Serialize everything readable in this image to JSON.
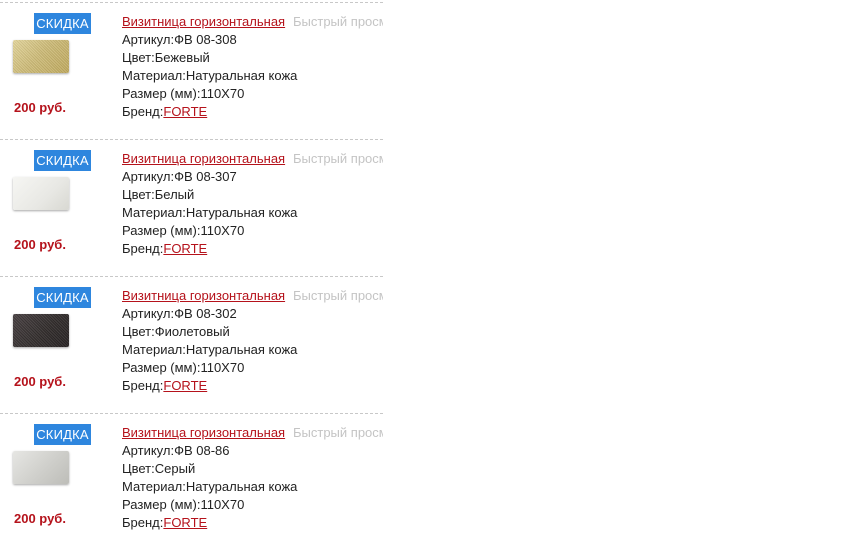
{
  "products": [
    {
      "badge": "СКИДКА",
      "title": "Визитница горизонтальная",
      "quick_view": "Быстрый просмотр",
      "article_label": "Артикул:",
      "article": "ФВ 08-308",
      "color_label": "Цвет:",
      "color": "Бежевый",
      "material_label": "Материал:",
      "material": "Натуральная кожа",
      "size_label": "Размер (мм):",
      "size": "110Х70",
      "brand_label": "Бренд:",
      "brand": "FORTE",
      "price": "200 руб."
    },
    {
      "badge": "СКИДКА",
      "title": "Визитница горизонтальная",
      "quick_view": "Быстрый просмотр",
      "article_label": "Артикул:",
      "article": "ФВ 08-307",
      "color_label": "Цвет:",
      "color": "Белый",
      "material_label": "Материал:",
      "material": "Натуральная кожа",
      "size_label": "Размер (мм):",
      "size": "110Х70",
      "brand_label": "Бренд:",
      "brand": "FORTE",
      "price": "200 руб."
    },
    {
      "badge": "СКИДКА",
      "title": "Визитница горизонтальная",
      "quick_view": "Быстрый просмотр",
      "article_label": "Артикул:",
      "article": "ФВ 08-302",
      "color_label": "Цвет:",
      "color": "Фиолетовый",
      "material_label": "Материал:",
      "material": "Натуральная кожа",
      "size_label": "Размер (мм):",
      "size": "110Х70",
      "brand_label": "Бренд:",
      "brand": "FORTE",
      "price": "200 руб."
    },
    {
      "badge": "СКИДКА",
      "title": "Визитница горизонтальная",
      "quick_view": "Быстрый просмотр",
      "article_label": "Артикул:",
      "article": "ФВ 08-86",
      "color_label": "Цвет:",
      "color": "Серый",
      "material_label": "Материал:",
      "material": "Натуральная кожа",
      "size_label": "Размер (мм):",
      "size": "110Х70",
      "brand_label": "Бренд:",
      "brand": "FORTE",
      "price": "200 руб."
    }
  ],
  "colors": {
    "badge_bg": "#2e86de",
    "accent_red": "#b5121b",
    "muted_link": "#c4c4c4",
    "divider": "#c8c8c8"
  }
}
